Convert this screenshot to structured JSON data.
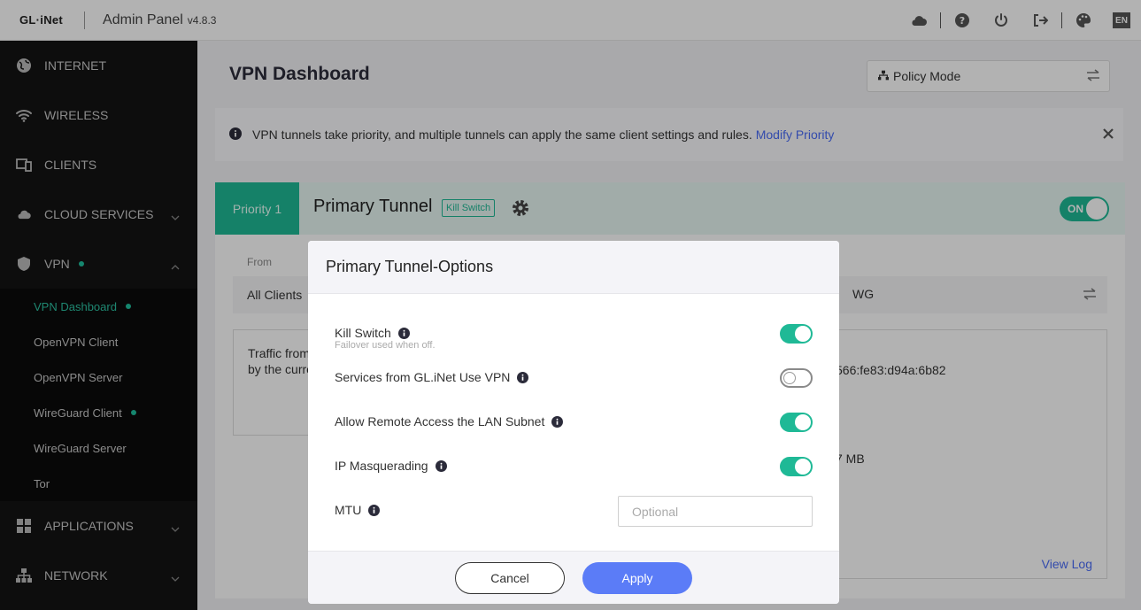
{
  "header": {
    "logo": "GL·iNet",
    "title": "Admin Panel",
    "version": "v4.8.3",
    "language": "EN",
    "icons": [
      "cloud-icon",
      "help-icon",
      "power-icon",
      "logout-icon",
      "theme-icon"
    ]
  },
  "sidebar": {
    "items": [
      {
        "label": "INTERNET",
        "icon": "globe-icon"
      },
      {
        "label": "WIRELESS",
        "icon": "wifi-icon"
      },
      {
        "label": "CLIENTS",
        "icon": "devices-icon"
      },
      {
        "label": "CLOUD SERVICES",
        "icon": "cloud-icon"
      },
      {
        "label": "VPN",
        "icon": "shield-icon"
      },
      {
        "label": "APPLICATIONS",
        "icon": "apps-icon"
      },
      {
        "label": "NETWORK",
        "icon": "network-icon"
      }
    ],
    "vpn_sub": [
      {
        "label": "VPN Dashboard"
      },
      {
        "label": "OpenVPN Client"
      },
      {
        "label": "OpenVPN Server"
      },
      {
        "label": "WireGuard Client"
      },
      {
        "label": "WireGuard Server"
      },
      {
        "label": "Tor"
      }
    ]
  },
  "main": {
    "title": "VPN Dashboard",
    "policy_mode": "Policy Mode",
    "banner_text": "VPN tunnels take priority, and multiple tunnels can apply the same client settings and rules.",
    "banner_link": "Modify Priority",
    "tunnel": {
      "priority": "Priority 1",
      "name": "Primary Tunnel",
      "badge": "Kill Switch",
      "status": "ON",
      "from_label": "From",
      "from_value": "All Clients",
      "to_value_partial": "WG",
      "traffic_line1": "Traffic from",
      "traffic_line2": "by the curre",
      "ipv6_partial": "566:fe83:d94a:6b82",
      "data_partial": "7 MB",
      "view_log": "View Log"
    }
  },
  "modal": {
    "title": "Primary Tunnel-Options",
    "options": [
      {
        "label": "Kill Switch",
        "sub": "Failover used when off.",
        "enabled": true
      },
      {
        "label": "Services from GL.iNet Use VPN",
        "enabled": false
      },
      {
        "label": "Allow Remote Access the LAN Subnet",
        "enabled": true
      },
      {
        "label": "IP Masquerading",
        "enabled": true
      }
    ],
    "mtu_label": "MTU",
    "mtu_placeholder": "Optional",
    "cancel": "Cancel",
    "apply": "Apply"
  }
}
